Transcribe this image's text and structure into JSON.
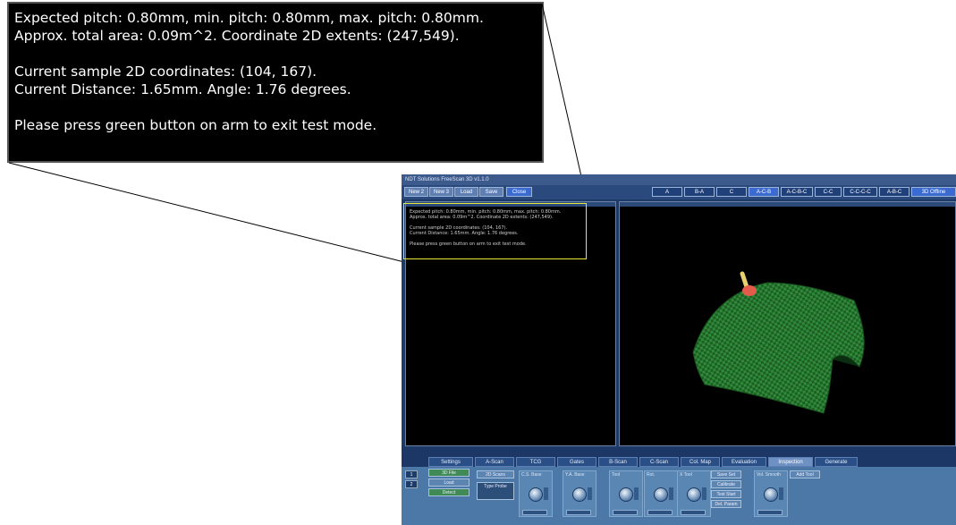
{
  "callout": {
    "line1": "Expected pitch: 0.80mm, min. pitch: 0.80mm, max. pitch: 0.80mm.",
    "line2": "Approx. total area: 0.09m^2. Coordinate 2D extents: (247,549).",
    "line3": "Current sample 2D coordinates: (104, 167).",
    "line4": "Current Distance: 1.65mm. Angle: 1.76 degrees.",
    "line5": "Please press green button on arm to exit test mode."
  },
  "app": {
    "title": "NDT Solutions FreeScan 3D v1.1.0",
    "toolbar_left": [
      "New 2",
      "New 3",
      "Load",
      "Save",
      "Close"
    ],
    "toolbar_right": [
      "A",
      "B-A",
      "C",
      "A-C-B",
      "A-C-B-C",
      "C-C",
      "C-C-C-C",
      "A-B-C",
      "3D Offline"
    ],
    "tabs": [
      "Settings",
      "A-Scan",
      "TCG",
      "Gates",
      "B-Scan",
      "C-Scan",
      "Col. Map",
      "Evaluation",
      "Inspection",
      "Generate"
    ],
    "active_tab": "Inspection",
    "channels": [
      "1",
      "2"
    ],
    "control_buttons": [
      "3D File",
      "Load",
      "Detect"
    ],
    "scan_buttons": [
      "2D Scans",
      "Type Probe"
    ],
    "knob_groups": [
      "C.S. Base",
      "Y.A. Base",
      "Tool",
      "Rot.",
      "X Tool",
      "Vol. Smooth"
    ],
    "side_buttons": [
      "Save Set",
      "Calibrate",
      "Test Start",
      "Del. Param"
    ],
    "extra_button": "Add Tool"
  },
  "colors": {
    "surface": "#2e7d32",
    "highlight": "#e8e83a",
    "probe_tip": "#e35b4a",
    "probe_body": "#e8d070"
  }
}
